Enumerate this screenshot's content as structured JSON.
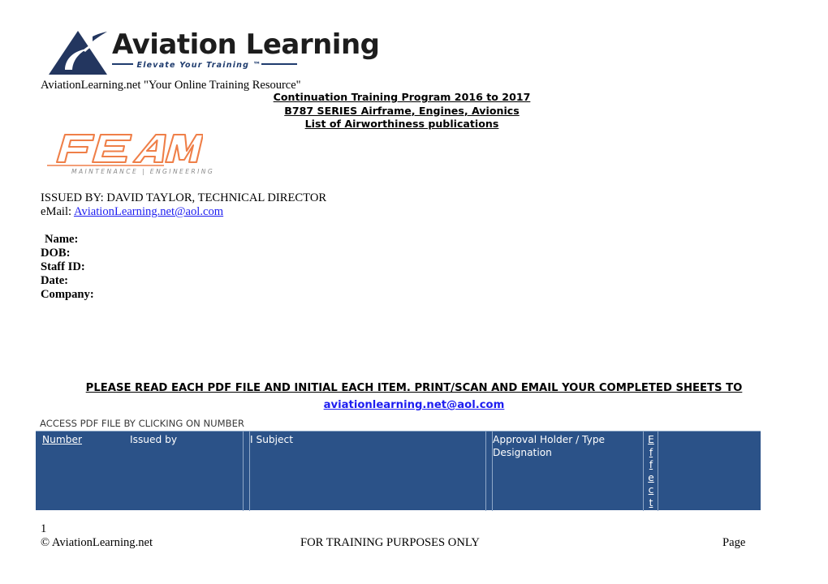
{
  "branding": {
    "aviation_learning": {
      "name": "Aviation Learning",
      "tagline": "Elevate Your Training ™",
      "subtitle": "AviationLearning.net \"Your Online Training Resource\"",
      "mark_icon": "aviation-triangle-swoosh-icon",
      "colors": {
        "mark": "#23365f",
        "word": "#1d1d1d",
        "tagline": "#1f3c6e"
      }
    },
    "feam": {
      "name": "FEAM",
      "subtitle": "MAINTENANCE  |  ENGINEERING",
      "mark_icon": "feam-outline-wordmark-icon",
      "colors": {
        "mark": "#ef7f48",
        "subtitle": "#8a8a8a"
      }
    }
  },
  "title": {
    "line1": "Continuation Training Program 2016 to 2017 ",
    "line2": "B787 SERIES  Airframe, Engines, Avionics",
    "line3": "List of Airworthiness publications "
  },
  "issued": {
    "issued_by": "ISSUED BY: DAVID TAYLOR, TECHNICAL DIRECTOR",
    "email_label": "eMail: ",
    "email": "AviationLearning.net@aol.com"
  },
  "fields": [
    {
      "label": "Name:"
    },
    {
      "label": "DOB:"
    },
    {
      "label": "Staff ID:"
    },
    {
      "label": "Date:"
    },
    {
      "label": "Company:"
    }
  ],
  "instructions": {
    "notice": "PLEASE READ EACH PDF FILE AND INITIAL EACH ITEM.  PRINT/SCAN AND EMAIL YOUR COMPLETED SHEETS TO",
    "email": "aviationlearning.net@aol.com",
    "access": "ACCESS PDF FILE BY CLICKING ON NUMBER"
  },
  "table": {
    "header_bg": "#2b5288",
    "headers": {
      "number": "Number",
      "issued_by": "Issued by",
      "subject": "I Subject",
      "approval": "Approval Holder / Type Designation",
      "effect": "Effect",
      "effect_letters": [
        "E",
        "f",
        "f",
        "e",
        "c",
        "t"
      ]
    },
    "rows": []
  },
  "footer": {
    "page_number": "1",
    "copyright": "© AviationLearning.net",
    "center": "FOR TRAINING PURPOSES ONLY",
    "page_label": "Page"
  }
}
